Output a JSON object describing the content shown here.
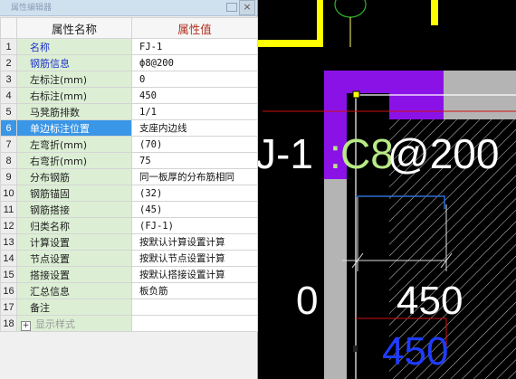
{
  "panel": {
    "title": "属性编辑器",
    "close_glyph": "×",
    "header_name": "属性名称",
    "header_value": "属性值",
    "rows": [
      {
        "n": "1",
        "name": "名称",
        "value": "FJ-1"
      },
      {
        "n": "2",
        "name": "钢筋信息",
        "value": "ф8@200"
      },
      {
        "n": "3",
        "name": "左标注(mm)",
        "value": "0"
      },
      {
        "n": "4",
        "name": "右标注(mm)",
        "value": "450"
      },
      {
        "n": "5",
        "name": "马凳筋排数",
        "value": "1/1"
      },
      {
        "n": "6",
        "name": "单边标注位置",
        "value": "支座内边线"
      },
      {
        "n": "7",
        "name": "左弯折(mm)",
        "value": "(70)"
      },
      {
        "n": "8",
        "name": "右弯折(mm)",
        "value": "75"
      },
      {
        "n": "9",
        "name": "分布钢筋",
        "value": "同一板厚的分布筋相同"
      },
      {
        "n": "10",
        "name": "钢筋锚固",
        "value": "(32)"
      },
      {
        "n": "11",
        "name": "钢筋搭接",
        "value": "(45)"
      },
      {
        "n": "12",
        "name": "归类名称",
        "value": "(FJ-1)"
      },
      {
        "n": "13",
        "name": "计算设置",
        "value": "按默认计算设置计算"
      },
      {
        "n": "14",
        "name": "节点设置",
        "value": "按默认节点设置计算"
      },
      {
        "n": "15",
        "name": "搭接设置",
        "value": "按默认搭接设置计算"
      },
      {
        "n": "16",
        "name": "汇总信息",
        "value": "板负筋"
      },
      {
        "n": "17",
        "name": "备注",
        "value": ""
      },
      {
        "n": "18",
        "name": "显示样式",
        "value": ""
      }
    ],
    "expander_glyph": "+"
  },
  "canvas": {
    "label_prefix": "J-1",
    "label_colon": ":",
    "label_rebar": "C8",
    "label_spacing": "@200",
    "dim_left": "0",
    "dim_right": "450",
    "dim_right_blue": "450",
    "colors": {
      "background": "#000000",
      "yellow": "#ffff00",
      "purple": "#8a12e6",
      "gray": "#b4b4b4",
      "label_white": "#ffffff",
      "label_green": "#b8e986",
      "dim_blue": "#1e3cff",
      "rebar_blue": "#2a6fd6",
      "red_line": "#d01010"
    }
  }
}
